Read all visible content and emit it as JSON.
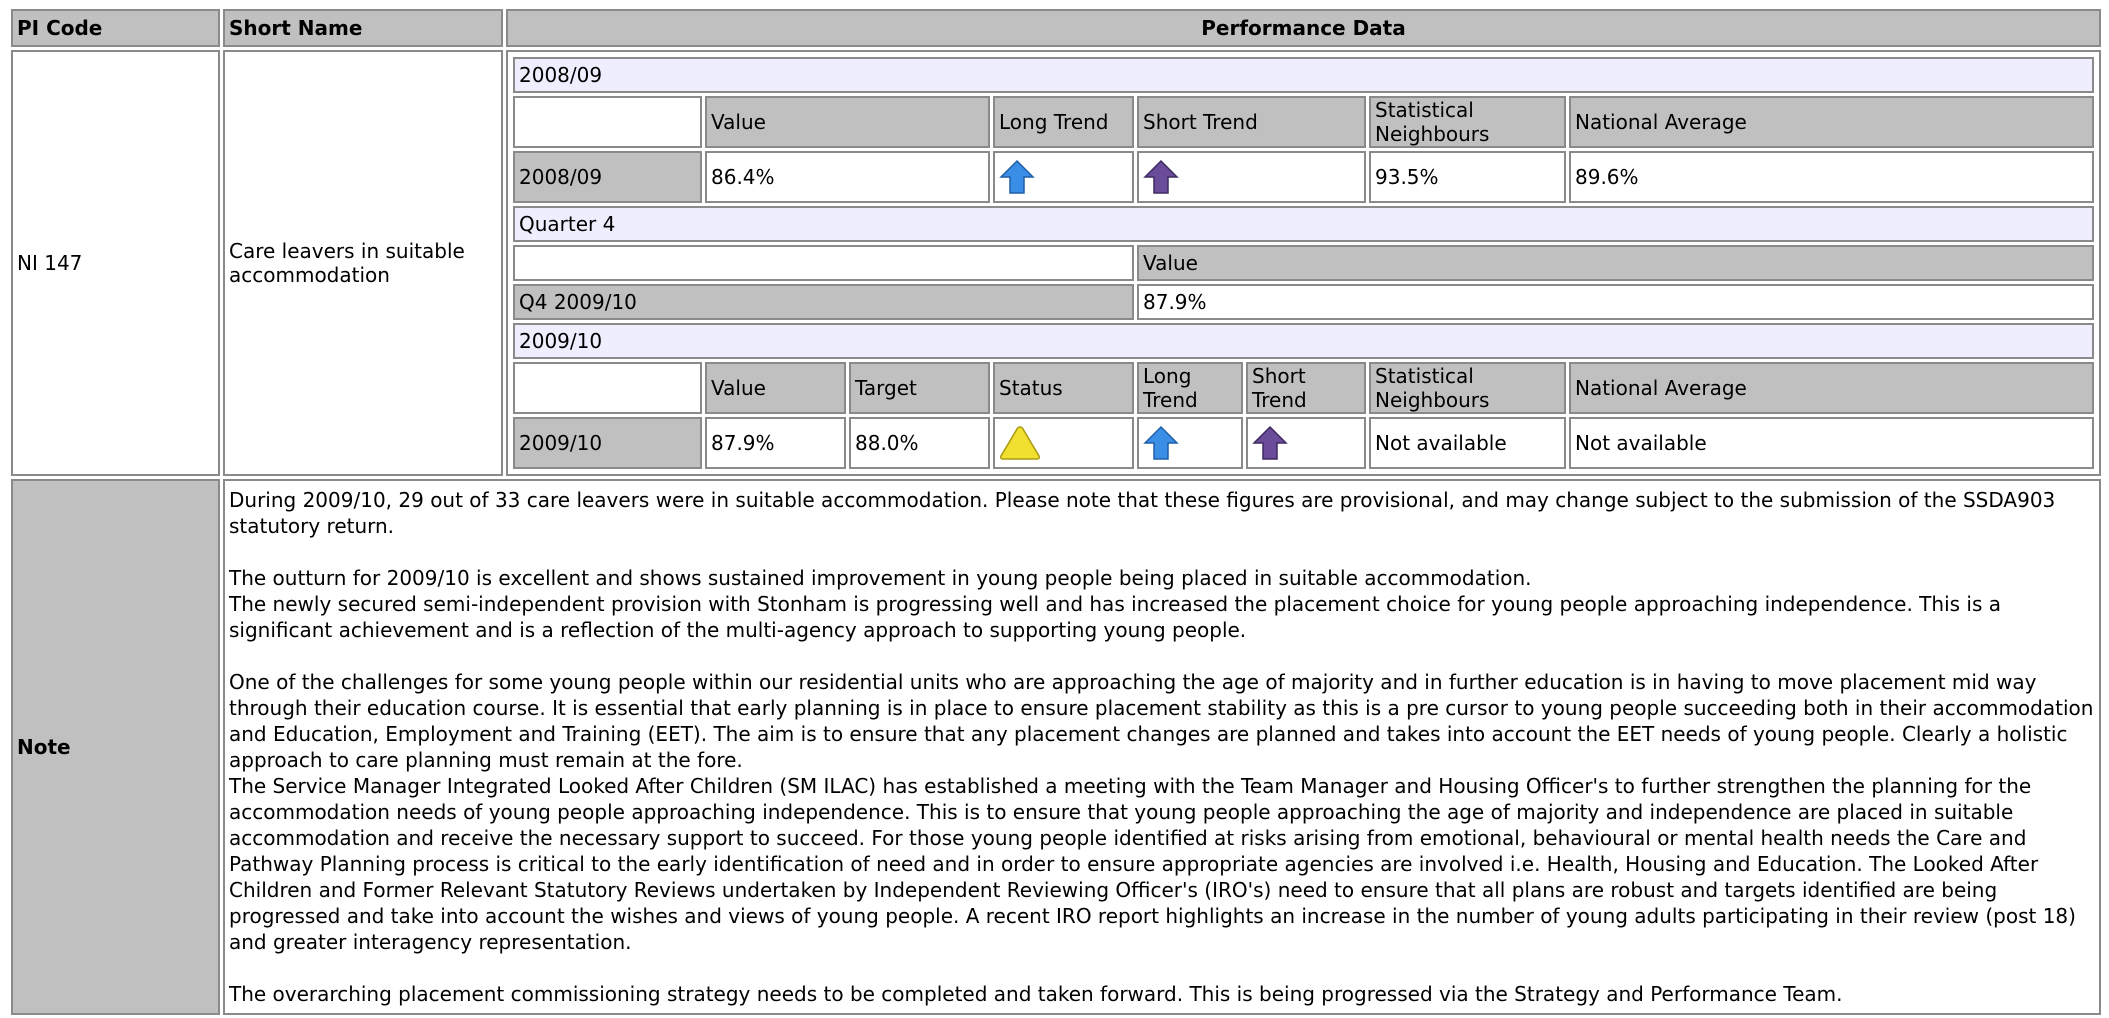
{
  "headers": {
    "pi_code": "PI Code",
    "short_name": "Short Name",
    "performance": "Performance Data"
  },
  "indicator": {
    "code": "NI 147",
    "short_name": "Care leavers in suitable accommodation"
  },
  "annual_2008": {
    "period": "2008/09",
    "columns": [
      "Value",
      "Long Trend",
      "Short Trend",
      "Statistical Neighbours",
      "National Average"
    ],
    "row_label": "2008/09",
    "value": "86.4%",
    "long_trend_icon": "arrow-up-blue-icon",
    "short_trend_icon": "arrow-up-purple-icon",
    "stat_neighbours": "93.5%",
    "national_average": "89.6%"
  },
  "quarter": {
    "period": "Quarter 4",
    "column": "Value",
    "row_label": "Q4 2009/10",
    "value": "87.9%"
  },
  "annual_2009": {
    "period": "2009/10",
    "columns": [
      "Value",
      "Target",
      "Status",
      "Long Trend",
      "Short Trend",
      "Statistical Neighbours",
      "National Average"
    ],
    "row_label": "2009/10",
    "value": "87.9%",
    "target": "88.0%",
    "status_icon": "warning-triangle-amber-icon",
    "long_trend_icon": "arrow-up-blue-icon",
    "short_trend_icon": "arrow-up-purple-icon",
    "stat_neighbours": "Not available",
    "national_average": "Not available"
  },
  "note": {
    "label": "Note",
    "p1": "During 2009/10, 29 out of 33 care leavers were in suitable accommodation. Please note that these figures are provisional, and may change subject to the submission of the SSDA903 statutory return.",
    "p2a": "The outturn for 2009/10 is excellent and shows sustained improvement in young people being placed in suitable accommodation.",
    "p2b": "The newly secured semi-independent provision with Stonham is progressing well and has increased the placement choice for young people approaching independence. This is a significant achievement and is a reflection of the multi-agency approach to supporting young people.",
    "p3a": "One of the challenges for some young people within our residential units who are approaching the age of majority and in further education is in having to move placement mid way through their education course. It is essential that early planning is in place to ensure placement stability as this is a pre cursor to young people succeeding both in their accommodation and Education, Employment and Training (EET). The aim is to ensure that any placement changes are planned and takes into account the EET needs of young people. Clearly a holistic approach to care planning must remain at the fore.",
    "p3b": "The Service Manager Integrated Looked After Children (SM ILAC) has established a meeting with the Team Manager and Housing Officer's to further strengthen the planning for the accommodation needs of young people approaching independence. This is to ensure that young people approaching the age of majority and independence are placed in suitable accommodation and receive the necessary support to succeed. For those young people identified at risks arising from emotional, behavioural or mental health needs the Care and Pathway Planning process is critical to the early identification of need and in order to ensure appropriate agencies are involved i.e. Health, Housing and Education. The Looked After Children and Former Relevant Statutory Reviews undertaken by Independent Reviewing Officer's (IRO's) need to ensure that all plans are robust and targets identified are being progressed and take into account the wishes and views of young people. A recent IRO report highlights an increase in the number of young adults participating in their review (post 18) and greater interagency representation.",
    "p4": "The overarching placement commissioning strategy needs to be completed and taken forward. This is being progressed via the Strategy and Performance Team."
  },
  "colors": {
    "header_bg": "#c0c0c0",
    "period_bg": "#eeeeff",
    "border": "#8a8a8a",
    "arrow_blue": "#3a8ee6",
    "arrow_purple": "#6b4c9a",
    "status_amber": "#f2e030"
  }
}
